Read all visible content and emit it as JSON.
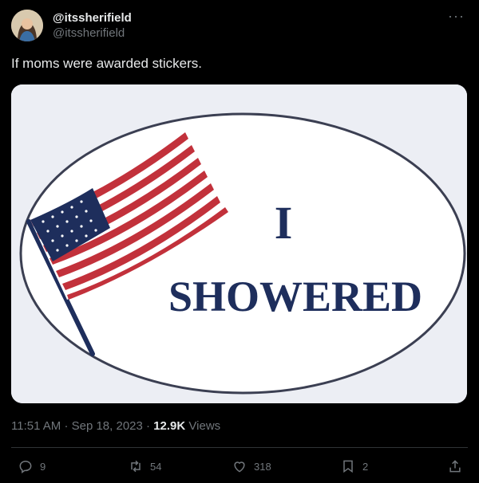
{
  "tweet": {
    "display_name": "@itssherifield",
    "handle": "@itssherifield",
    "text": "If moms were awarded stickers.",
    "time": "11:51 AM",
    "date": "Sep 18, 2023",
    "views_count": "12.9K",
    "views_label": "Views",
    "sep": "·"
  },
  "media": {
    "sticker_line1": "I",
    "sticker_line2": "SHOWERED"
  },
  "actions": {
    "replies": "9",
    "reposts": "54",
    "likes": "318",
    "bookmarks": "2"
  },
  "icons": [
    "more-icon",
    "reply-icon",
    "repost-icon",
    "like-icon",
    "bookmark-icon",
    "share-icon"
  ],
  "colors": {
    "background": "#000000",
    "text": "#e7e9ea",
    "muted": "#71767b",
    "sticker_navy": "#1e2e5c",
    "sticker_red": "#c2313b"
  }
}
